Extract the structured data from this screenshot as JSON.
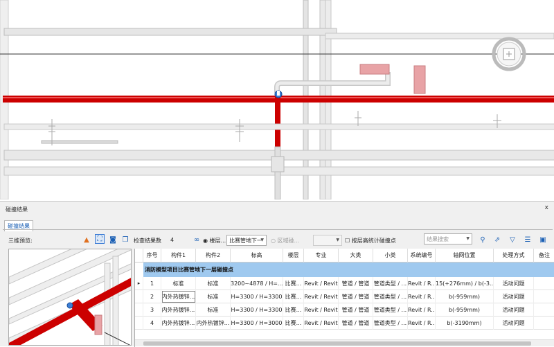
{
  "panel": {
    "title": "碰撞结果",
    "close": "x",
    "tab": "碰撞结果"
  },
  "toolbar": {
    "preview_label": "三维预览:",
    "count_label": "检查结果数",
    "count_value": "4",
    "floor_radio": "楼层...",
    "floor_select": "比赛管地下一",
    "area_radio": "区域碰...",
    "by_floor_checkbox": "按层高统计碰撞点",
    "search_placeholder": "结果搜索"
  },
  "table": {
    "columns": [
      "序号",
      "构件1",
      "构件2",
      "标高",
      "楼层",
      "专业",
      "大类",
      "小类",
      "系统编号",
      "轴网位置",
      "处理方式",
      "备注"
    ],
    "group_title": "消防模型项目比赛管地下一层碰撞点",
    "rows": [
      [
        "1",
        "标准",
        "标准",
        "3200~4878 / H=...",
        "比赛...",
        "Revit / Revit",
        "管道 / 管道",
        "管道类型 / ...",
        "Revit / R...",
        "15(+276mm) / b(-3...",
        "活动问题",
        ""
      ],
      [
        "2",
        "内外热镀锌...",
        "标准",
        "H=3300 / H=3300",
        "比赛...",
        "Revit / Revit",
        "管道 / 管道",
        "管道类型 / ...",
        "Revit / R...",
        "b(-959mm)",
        "活动问题",
        ""
      ],
      [
        "3",
        "内外热镀锌...",
        "标准",
        "H=3300 / H=3300",
        "比赛...",
        "Revit / Revit",
        "管道 / 管道",
        "管道类型 / ...",
        "Revit / R...",
        "b(-959mm)",
        "活动问题",
        ""
      ],
      [
        "4",
        "内外热镀锌...",
        "内外热镀锌...",
        "H=3300 / H=3000",
        "比赛...",
        "Revit / Revit",
        "管道 / 管道",
        "管道类型 / ...",
        "Revit / R...",
        "b(-3190mm)",
        "活动问题",
        ""
      ]
    ]
  },
  "colors": {
    "clash_pipe": "#cc0000",
    "header_group": "#9fc9ef",
    "accent": "#1a5fb4"
  }
}
